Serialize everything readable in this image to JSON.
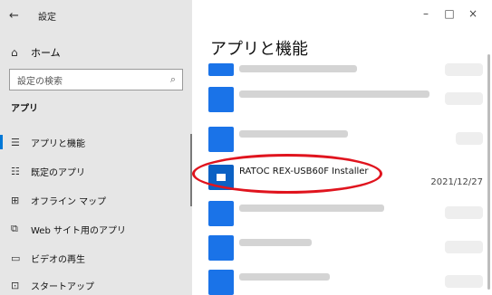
{
  "window": {
    "back_icon": "back-arrow-icon",
    "title": "設定",
    "minimize": "–",
    "maximize": "□",
    "close": "×"
  },
  "sidebar": {
    "home_label": "ホーム",
    "search_placeholder": "設定の検索",
    "section_title": "アプリ",
    "items": [
      {
        "label": "アプリと機能",
        "icon": "list-icon",
        "active": true
      },
      {
        "label": "既定のアプリ",
        "icon": "default-apps-icon"
      },
      {
        "label": "オフライン マップ",
        "icon": "map-icon"
      },
      {
        "label": "Web サイト用のアプリ",
        "icon": "website-icon"
      },
      {
        "label": "ビデオの再生",
        "icon": "video-icon"
      },
      {
        "label": "スタートアップ",
        "icon": "startup-icon"
      }
    ]
  },
  "main": {
    "title": "アプリと機能",
    "highlighted_app": {
      "name": "RATOC REX-USB60F Installer",
      "date": "2021/12/27"
    }
  },
  "colors": {
    "accent": "#0078d7",
    "app_icon_blue": "#1a73e8",
    "annotation_red": "#e0141e",
    "sidebar_bg": "#e6e6e6"
  }
}
